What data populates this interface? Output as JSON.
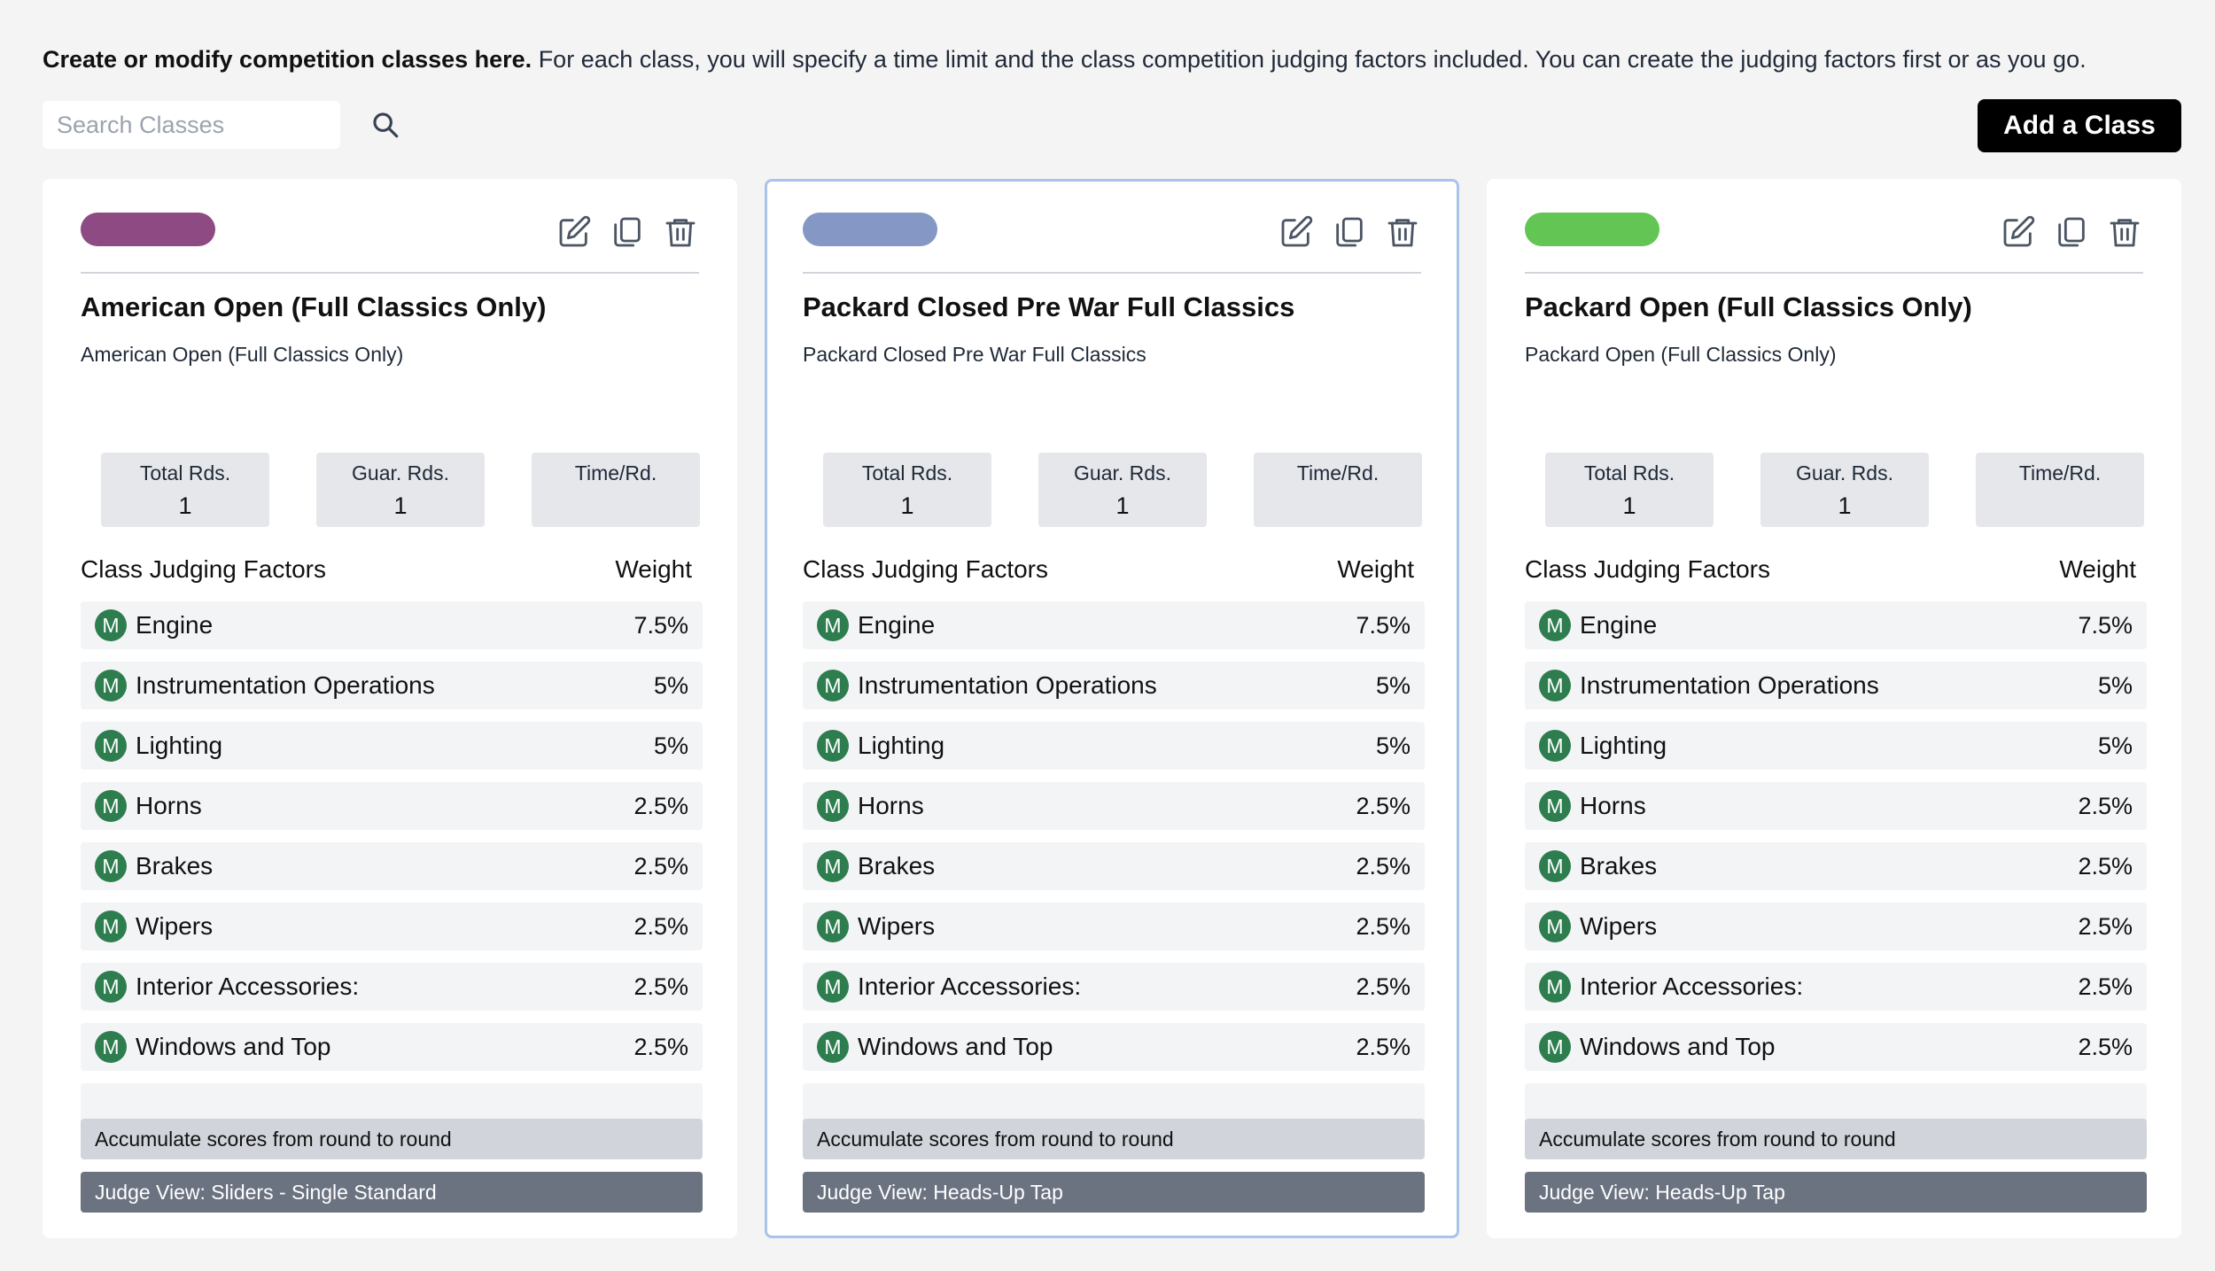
{
  "intro": {
    "bold": "Create or modify competition classes here.",
    "rest": " For each class, you will specify a time limit and the class competition judging factors included. You can create the judging factors first or as you go."
  },
  "search": {
    "placeholder": "Search Classes",
    "value": "",
    "icon": "search-icon"
  },
  "add_button": "Add a Class",
  "labels": {
    "total_rds": "Total Rds.",
    "guar_rds": "Guar. Rds.",
    "time_rd": "Time/Rd.",
    "factors_heading": "Class Judging Factors",
    "weight_heading": "Weight",
    "accumulate": "Accumulate scores from round to round"
  },
  "cards": [
    {
      "color": "#8e4a82",
      "title": "American Open (Full Classics Only)",
      "subtitle": "American Open (Full Classics Only)",
      "total_rds": "1",
      "guar_rds": "1",
      "time_rd": "",
      "judge_view": "Judge View: Sliders - Single Standard",
      "selected": false
    },
    {
      "color": "#8597c4",
      "title": "Packard Closed Pre War Full Classics",
      "subtitle": "Packard Closed Pre War Full Classics",
      "total_rds": "1",
      "guar_rds": "1",
      "time_rd": "",
      "judge_view": "Judge View: Heads-Up Tap",
      "selected": true
    },
    {
      "color": "#63c553",
      "title": "Packard Open (Full Classics Only)",
      "subtitle": "Packard Open (Full Classics Only)",
      "total_rds": "1",
      "guar_rds": "1",
      "time_rd": "",
      "judge_view": "Judge View: Heads-Up Tap",
      "selected": false
    }
  ],
  "factors": [
    {
      "badge": "M",
      "name": "Engine",
      "weight": "7.5%"
    },
    {
      "badge": "M",
      "name": "Instrumentation Operations",
      "weight": "5%"
    },
    {
      "badge": "M",
      "name": "Lighting",
      "weight": "5%"
    },
    {
      "badge": "M",
      "name": "Horns",
      "weight": "2.5%"
    },
    {
      "badge": "M",
      "name": "Brakes",
      "weight": "2.5%"
    },
    {
      "badge": "M",
      "name": "Wipers",
      "weight": "2.5%"
    },
    {
      "badge": "M",
      "name": "Interior Accessories:",
      "weight": "2.5%"
    },
    {
      "badge": "M",
      "name": "Windows and Top",
      "weight": "2.5%"
    },
    {
      "badge": "",
      "name": "",
      "weight": ""
    }
  ],
  "icons": {
    "edit": "edit-icon",
    "copy": "copy-icon",
    "delete": "trash-icon"
  }
}
